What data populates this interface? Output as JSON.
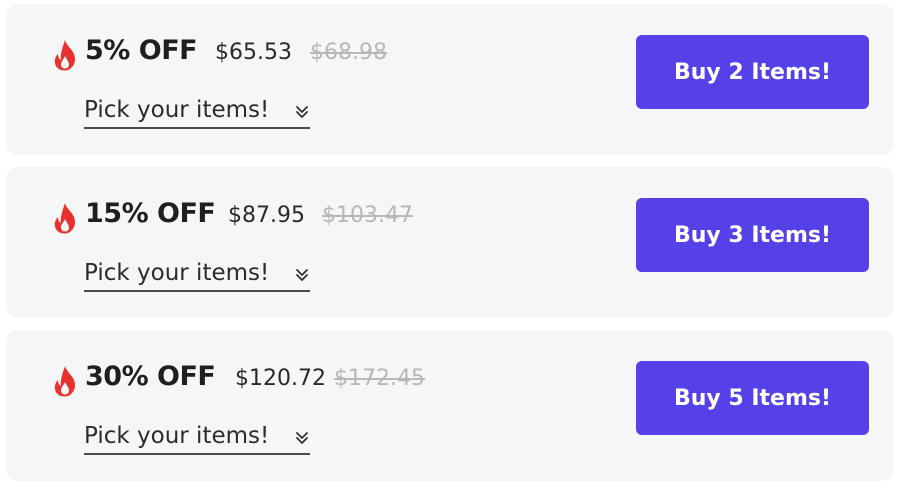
{
  "offers": [
    {
      "icon": "fire-icon",
      "discount": "5% OFF",
      "price": "$65.53",
      "old_price": "$68.98",
      "picker_label": "Pick your items!",
      "button_label": "Buy 2 Items!"
    },
    {
      "icon": "fire-icon",
      "discount": "15% OFF",
      "price": "$87.95",
      "old_price": "$103.47",
      "picker_label": "Pick your items!",
      "button_label": "Buy 3 Items!"
    },
    {
      "icon": "fire-icon",
      "discount": "30% OFF",
      "price": "$120.72",
      "old_price": "$172.45",
      "picker_label": "Pick your items!",
      "button_label": "Buy 5 Items!"
    }
  ],
  "colors": {
    "card_background": "#f5f6f8",
    "button": "#5640e8",
    "fire": "#e8322e",
    "old_price": "#b8b8b8"
  }
}
